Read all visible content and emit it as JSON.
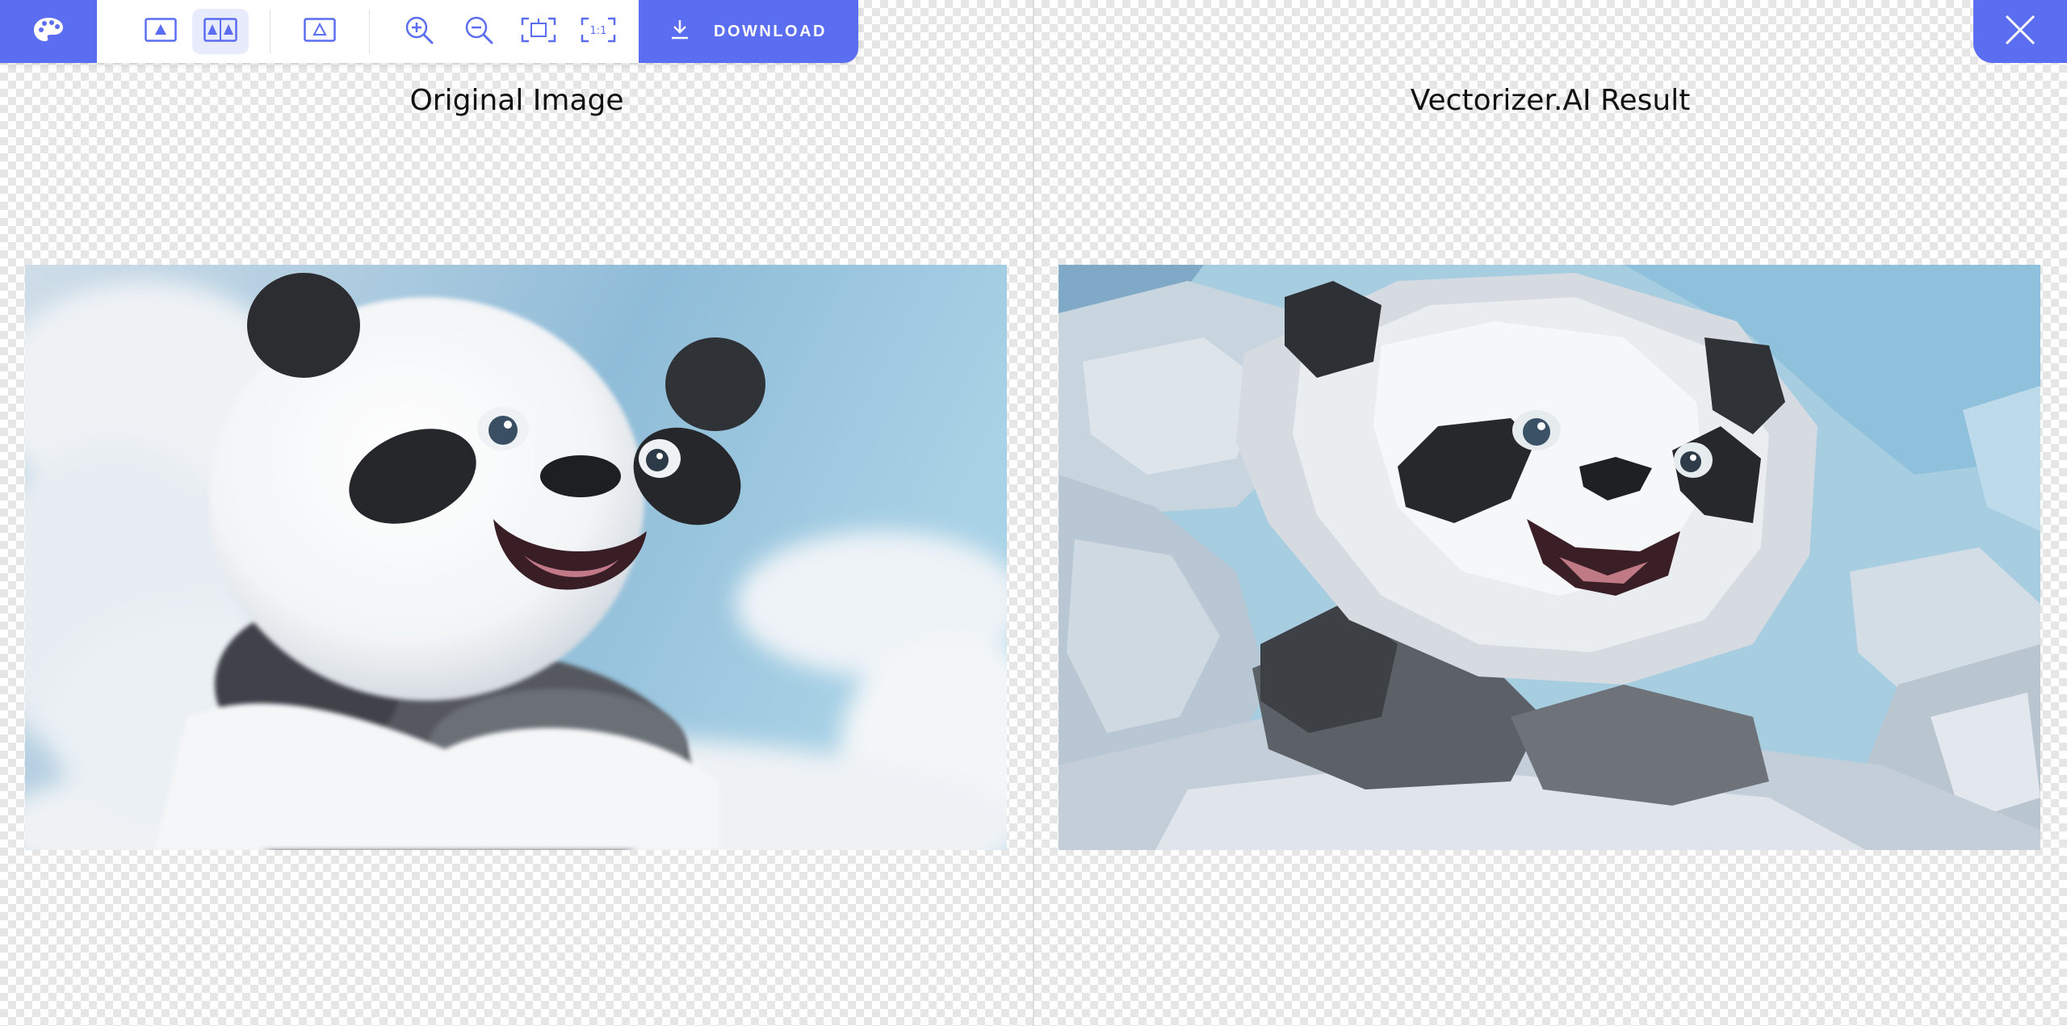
{
  "toolbar": {
    "logo_icon": "palette-icon",
    "view_buttons": [
      {
        "name": "single-view",
        "icon": "single-image-icon",
        "active": false
      },
      {
        "name": "side-by-side-view",
        "icon": "side-by-side-icon",
        "active": true
      },
      {
        "name": "vector-view",
        "icon": "outline-triangle-icon",
        "active": false
      }
    ],
    "zoom_buttons": [
      {
        "name": "zoom-in",
        "icon": "zoom-in-icon"
      },
      {
        "name": "zoom-out",
        "icon": "zoom-out-icon"
      },
      {
        "name": "fit",
        "icon": "fit-to-screen-icon"
      },
      {
        "name": "actual-size",
        "icon": "one-to-one-icon"
      }
    ],
    "download_label": "DOWNLOAD",
    "accent_color": "#5b6df0"
  },
  "panels": {
    "left_title": "Original Image",
    "right_title": "Vectorizer.AI Result"
  }
}
